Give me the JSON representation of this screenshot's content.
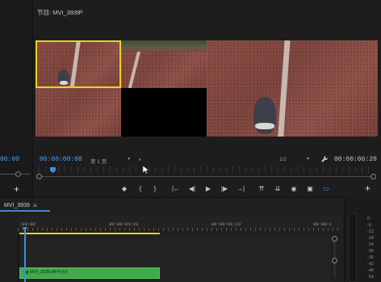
{
  "left_panel": {
    "timecode": "00:00",
    "add_button": "+"
  },
  "program_monitor": {
    "title": "节目: MVI_3939",
    "menu_icon": "≡",
    "current_time": "00:00:00:08",
    "fit_label": "第 1 页",
    "fit_arrow": "▾",
    "separator": "▸",
    "resolution_label": "1/2",
    "resolution_arrow": "▾",
    "duration": "00:00:06:20",
    "add_button": "+"
  },
  "controls": [
    {
      "name": "add-marker-button",
      "glyph": "◆"
    },
    {
      "name": "mark-in-button",
      "glyph": "{"
    },
    {
      "name": "mark-out-button",
      "glyph": "}"
    },
    {
      "name": "go-to-in-button",
      "glyph": "|←"
    },
    {
      "name": "step-back-button",
      "glyph": "◀|"
    },
    {
      "name": "play-button",
      "glyph": "▶"
    },
    {
      "name": "step-forward-button",
      "glyph": "|▶"
    },
    {
      "name": "go-to-out-button",
      "glyph": "→|"
    },
    {
      "name": "lift-button",
      "glyph": "⇈"
    },
    {
      "name": "extract-button",
      "glyph": "⇊"
    },
    {
      "name": "export-frame-button",
      "glyph": "◉"
    },
    {
      "name": "comparison-view-button",
      "glyph": "▣"
    },
    {
      "name": "toggle-proxy-button",
      "glyph": "▭"
    }
  ],
  "timeline": {
    "tab_title": "MVI_3939",
    "menu_icon": "≡",
    "ticks": [
      ":00:00",
      "00:00:04:23",
      "00:00:09:23",
      "00:00:1"
    ],
    "clip_label": "MVI_3939.MP4 [V]"
  },
  "meters": {
    "ticks": [
      "0",
      "-6",
      "-12",
      "-18",
      "-24",
      "-30",
      "-36",
      "-42",
      "-48",
      "-54"
    ]
  },
  "colors": {
    "accent": "#4aa3ff",
    "clip": "#3fa94b",
    "selection": "#e8d420"
  }
}
